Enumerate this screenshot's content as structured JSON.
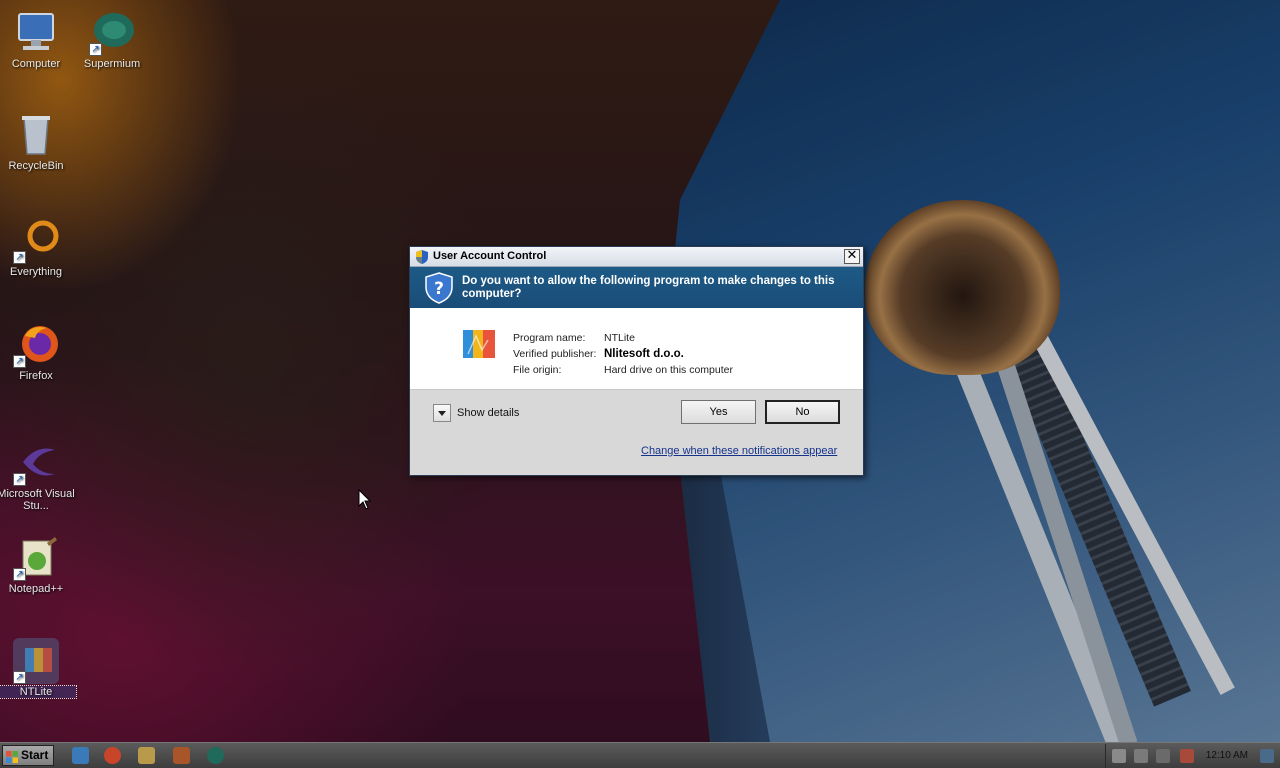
{
  "desktop": {
    "icons": [
      {
        "label": "Computer",
        "icon": "computer-icon"
      },
      {
        "label": "Supermium",
        "icon": "supermium-icon"
      },
      {
        "label": "RecycleBin",
        "icon": "recycle-bin-icon"
      },
      {
        "label": "Everything",
        "icon": "everything-icon"
      },
      {
        "label": "Firefox",
        "icon": "firefox-icon"
      },
      {
        "label": "Microsoft Visual Stu...",
        "icon": "visual-studio-icon"
      },
      {
        "label": "Notepad++",
        "icon": "notepadpp-icon"
      },
      {
        "label": "NTLite",
        "icon": "ntlite-icon"
      }
    ]
  },
  "uac": {
    "title": "User Account Control",
    "close_glyph": "✕",
    "question": "Do you want to allow the following program to make changes to this computer?",
    "program_name_label": "Program name:",
    "program_name": "NTLite",
    "publisher_label": "Verified publisher:",
    "publisher": "Nlitesoft d.o.o.",
    "origin_label": "File origin:",
    "origin": "Hard drive on this computer",
    "show_details": "Show details",
    "yes": "Yes",
    "no": "No",
    "notifications_link": "Change when these notifications appear"
  },
  "taskbar": {
    "start_label": "Start",
    "clock": "12:10 AM"
  },
  "colors": {
    "uac_header": "#1d5a86",
    "link": "#16338c"
  }
}
